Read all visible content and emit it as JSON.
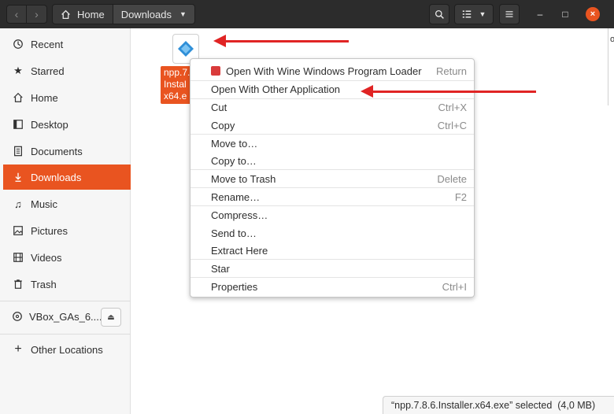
{
  "header": {
    "back_icon": "chevron-left-icon",
    "forward_icon": "chevron-right-icon",
    "path_home": "Home",
    "path_current": "Downloads",
    "search_icon": "search-icon",
    "view_icon": "list-view-icon",
    "menu_icon": "hamburger-icon",
    "minimize": "–",
    "maximize": "□",
    "close": "×"
  },
  "sidebar": {
    "items": [
      {
        "label": "Recent",
        "icon": "clock-icon"
      },
      {
        "label": "Starred",
        "icon": "star-icon"
      },
      {
        "label": "Home",
        "icon": "home-icon"
      },
      {
        "label": "Desktop",
        "icon": "desktop-icon"
      },
      {
        "label": "Documents",
        "icon": "document-icon"
      },
      {
        "label": "Downloads",
        "icon": "download-icon",
        "active": true
      },
      {
        "label": "Music",
        "icon": "music-icon"
      },
      {
        "label": "Pictures",
        "icon": "picture-icon"
      },
      {
        "label": "Videos",
        "icon": "video-icon"
      },
      {
        "label": "Trash",
        "icon": "trash-icon"
      }
    ],
    "device": {
      "label": "VBox_GAs_6....",
      "icon": "disc-icon",
      "eject_icon": "eject-icon"
    },
    "other": {
      "label": "Other Locations",
      "icon": "plus-icon"
    }
  },
  "file": {
    "name_lines": [
      "npp.7.",
      "Instal",
      "x64.e"
    ],
    "icon": "notepadpp-icon"
  },
  "context_menu": {
    "items": [
      {
        "label": "Open With Wine Windows Program Loader",
        "accel": "Return",
        "icon": "wine-icon"
      },
      {
        "label": "Open With Other Application",
        "accel": ""
      },
      {
        "label": "Cut",
        "accel": "Ctrl+X"
      },
      {
        "label": "Copy",
        "accel": "Ctrl+C"
      },
      {
        "label": "Move to…",
        "accel": ""
      },
      {
        "label": "Copy to…",
        "accel": ""
      },
      {
        "label": "Move to Trash",
        "accel": "Delete"
      },
      {
        "label": "Rename…",
        "accel": "F2"
      },
      {
        "label": "Compress…",
        "accel": ""
      },
      {
        "label": "Send to…",
        "accel": ""
      },
      {
        "label": "Extract Here",
        "accel": ""
      },
      {
        "label": "Star",
        "accel": ""
      },
      {
        "label": "Properties",
        "accel": "Ctrl+I"
      }
    ]
  },
  "status": {
    "text": "“npp.7.8.6.Installer.x64.exe” selected  (4,0 MB)"
  },
  "edge_text": "o",
  "colors": {
    "accent": "#e95420",
    "headerbar": "#2c2c2c",
    "arrow": "#e02424"
  }
}
